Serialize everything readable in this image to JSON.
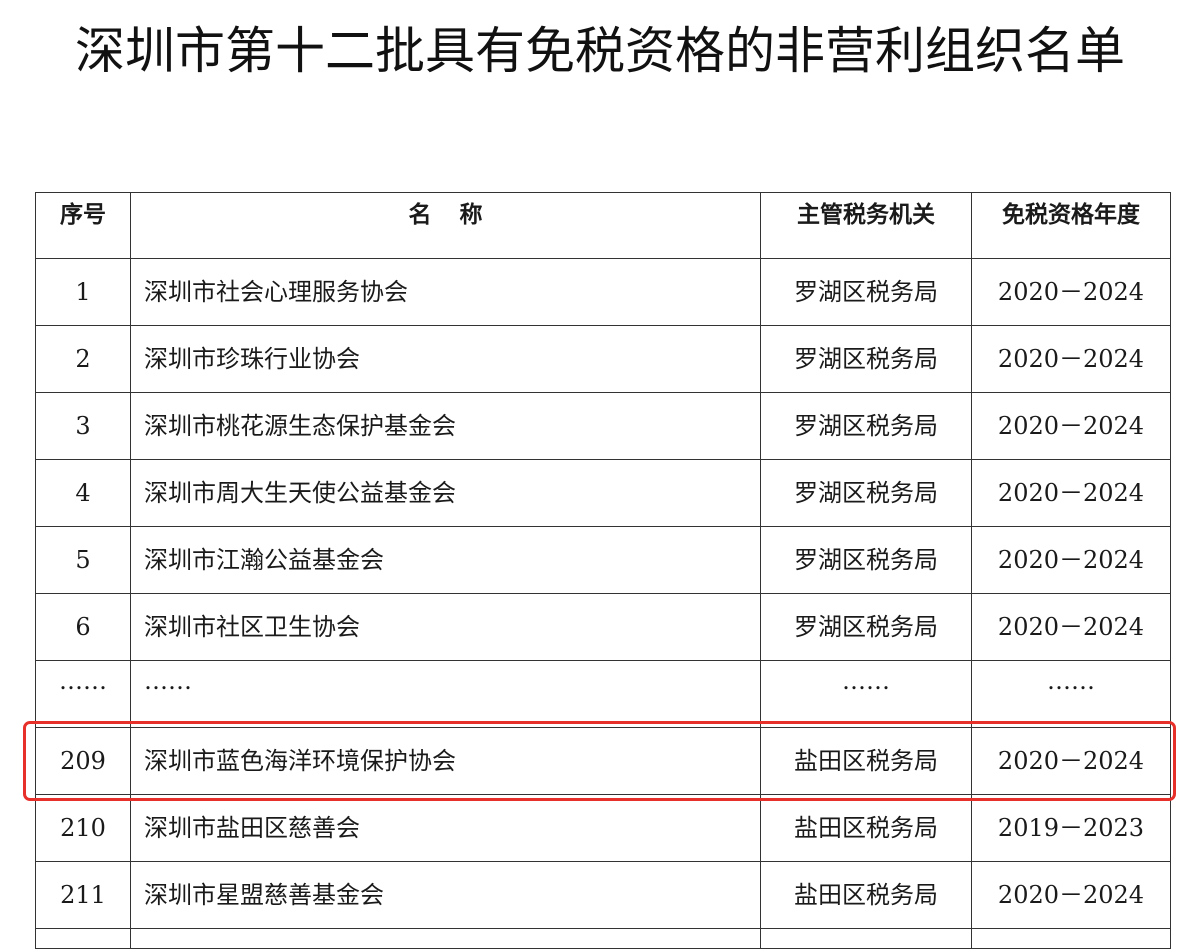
{
  "title": "深圳市第十二批具有免税资格的非营利组织名单",
  "table": {
    "headers": {
      "num": "序号",
      "name": "名称",
      "office": "主管税务机关",
      "years": "免税资格年度"
    },
    "rows": [
      {
        "num": "1",
        "name": "深圳市社会心理服务协会",
        "office": "罗湖区税务局",
        "years": "2020－2024"
      },
      {
        "num": "2",
        "name": "深圳市珍珠行业协会",
        "office": "罗湖区税务局",
        "years": "2020－2024"
      },
      {
        "num": "3",
        "name": "深圳市桃花源生态保护基金会",
        "office": "罗湖区税务局",
        "years": "2020－2024"
      },
      {
        "num": "4",
        "name": "深圳市周大生天使公益基金会",
        "office": "罗湖区税务局",
        "years": "2020－2024"
      },
      {
        "num": "5",
        "name": "深圳市江瀚公益基金会",
        "office": "罗湖区税务局",
        "years": "2020－2024"
      },
      {
        "num": "6",
        "name": "深圳市社区卫生协会",
        "office": "罗湖区税务局",
        "years": "2020－2024"
      },
      {
        "num": "……",
        "name": "……",
        "office": "……",
        "years": "……"
      },
      {
        "num": "209",
        "name": "深圳市蓝色海洋环境保护协会",
        "office": "盐田区税务局",
        "years": "2020－2024"
      },
      {
        "num": "210",
        "name": "深圳市盐田区慈善会",
        "office": "盐田区税务局",
        "years": "2019－2023"
      },
      {
        "num": "211",
        "name": "深圳市星盟慈善基金会",
        "office": "盐田区税务局",
        "years": "2020－2024"
      }
    ]
  },
  "highlight_color": "#e8302a"
}
